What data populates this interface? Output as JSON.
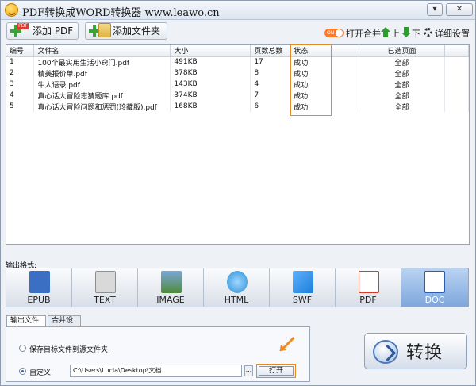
{
  "window": {
    "title": "PDF转换成WORD转换器 www.leawo.cn",
    "buttons": {
      "minimize": "▾",
      "maximize": "□",
      "close": "✕"
    }
  },
  "toolbar": {
    "add_pdf": "添加 PDF",
    "add_folder": "添加文件夹",
    "toggle_text": "ON",
    "open_merge": "打开合并",
    "move_up": "上",
    "move_down": "下",
    "settings": "详细设置"
  },
  "table": {
    "columns": [
      "编号",
      "文件名",
      "大小",
      "页数总数",
      "状态",
      "已选页面"
    ],
    "rows": [
      {
        "no": "1",
        "name": "100个最实用生活小窍门.pdf",
        "size": "491KB",
        "pages": "17",
        "status": "成功",
        "selected": "全部"
      },
      {
        "no": "2",
        "name": "精美报价单.pdf",
        "size": "378KB",
        "pages": "8",
        "status": "成功",
        "selected": "全部"
      },
      {
        "no": "3",
        "name": "牛人语录.pdf",
        "size": "143KB",
        "pages": "4",
        "status": "成功",
        "selected": "全部"
      },
      {
        "no": "4",
        "name": "真心话大冒险志猜题库.pdf",
        "size": "374KB",
        "pages": "7",
        "status": "成功",
        "selected": "全部"
      },
      {
        "no": "5",
        "name": "真心话大冒险问题和惩罚(珍藏版).pdf",
        "size": "168KB",
        "pages": "6",
        "status": "成功",
        "selected": "全部"
      }
    ]
  },
  "output": {
    "label": "输出格式:",
    "formats": [
      {
        "label": "EPUB",
        "icon": "epub-icon",
        "color": "#3b6fc4"
      },
      {
        "label": "TEXT",
        "icon": "text-icon",
        "color": "#8e8e8e"
      },
      {
        "label": "IMAGE",
        "icon": "image-icon",
        "color": "#4f8a3c"
      },
      {
        "label": "HTML",
        "icon": "html-icon",
        "color": "#2b8fd6"
      },
      {
        "label": "SWF",
        "icon": "swf-icon",
        "color": "#1c7fd8"
      },
      {
        "label": "PDF",
        "icon": "pdf-icon",
        "color": "#d63a2a"
      },
      {
        "label": "DOC",
        "icon": "doc-icon",
        "color": "#2a5db0"
      }
    ],
    "selected": "DOC"
  },
  "settings": {
    "tabs": [
      "输出文件夹",
      "合并设置"
    ],
    "option_source": "保存目标文件到源文件夹.",
    "option_custom": "自定义:",
    "path": "C:\\Users\\Lucia\\Desktop\\文档",
    "browse": "...",
    "open": "打开"
  },
  "convert": {
    "label": "转换"
  },
  "colors": {
    "highlight_orange": "#e88a24",
    "active_format": "#7ea7dc"
  }
}
